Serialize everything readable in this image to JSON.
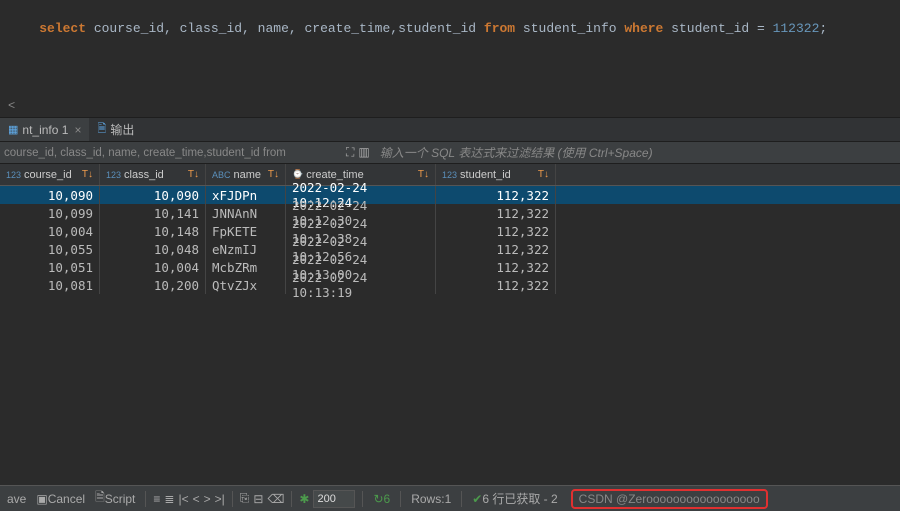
{
  "editor": {
    "sql": {
      "kw_select": "select",
      "cols": " course_id, class_id, name, create_time,student_id ",
      "kw_from": "from",
      "table": " student_info ",
      "kw_where": "where",
      "cond": " student_id = ",
      "lit": "112322",
      "semi": ";"
    },
    "scroll_left_glyph": "<"
  },
  "tabs": [
    {
      "label": "nt_info 1",
      "icon": "grid",
      "close": "×",
      "active": true
    },
    {
      "label": "输出",
      "icon": "doc",
      "close": "",
      "active": false
    }
  ],
  "filter": {
    "visible_sql": "course_id, class_id, name, create_time,student_id from",
    "placeholder": "输入一个 SQL 表达式来过滤结果 (使用 Ctrl+Space)"
  },
  "columns": [
    {
      "name": "course_id",
      "type": "123",
      "width": "w-course",
      "align": "num-right"
    },
    {
      "name": "class_id",
      "type": "123",
      "width": "w-class",
      "align": "num-right"
    },
    {
      "name": "name",
      "type": "ABC",
      "width": "w-name",
      "align": ""
    },
    {
      "name": "create_time",
      "type": "⌚",
      "width": "w-time",
      "align": ""
    },
    {
      "name": "student_id",
      "type": "123",
      "width": "w-stu",
      "align": "num-right"
    }
  ],
  "rows": [
    {
      "course_id": "10,090",
      "class_id": "10,090",
      "name": "xFJDPn",
      "create_time": "2022-02-24 10:12:24",
      "student_id": "112,322",
      "selected": true
    },
    {
      "course_id": "10,099",
      "class_id": "10,141",
      "name": "JNNAnN",
      "create_time": "2022-02-24 10:12:30",
      "student_id": "112,322",
      "selected": false
    },
    {
      "course_id": "10,004",
      "class_id": "10,148",
      "name": "FpKETE",
      "create_time": "2022-02-24 10:12:38",
      "student_id": "112,322",
      "selected": false
    },
    {
      "course_id": "10,055",
      "class_id": "10,048",
      "name": "eNzmIJ",
      "create_time": "2022-02-24 10:12:56",
      "student_id": "112,322",
      "selected": false
    },
    {
      "course_id": "10,051",
      "class_id": "10,004",
      "name": "McbZRm",
      "create_time": "2022-02-24 10:13:00",
      "student_id": "112,322",
      "selected": false
    },
    {
      "course_id": "10,081",
      "class_id": "10,200",
      "name": "QtvZJx",
      "create_time": "2022-02-24 10:13:19",
      "student_id": "112,322",
      "selected": false
    }
  ],
  "status": {
    "save": "ave",
    "cancel": "Cancel",
    "script": "Script",
    "page_size": "200",
    "refresh": "↻",
    "refresh_n": "6",
    "rows_label": "Rows:",
    "rows_n": "1",
    "fetched": "6 行已获取 - 2",
    "watermark": "CSDN @Zerooooooooooooooooo"
  }
}
